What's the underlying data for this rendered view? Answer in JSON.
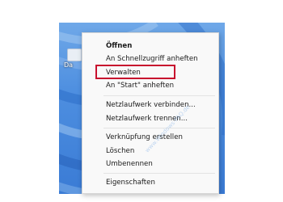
{
  "desktop": {
    "icon_label": "Da"
  },
  "context_menu": {
    "items": [
      {
        "label": "Öffnen",
        "bold": true
      },
      {
        "label": "An Schnellzugriff anheften"
      },
      {
        "label": "Verwalten",
        "highlighted": true
      },
      {
        "label": "An \"Start\" anheften"
      },
      {
        "label": "Netzlaufwerk verbinden..."
      },
      {
        "label": "Netzlaufwerk trennen..."
      },
      {
        "label": "Verknüpfung erstellen"
      },
      {
        "label": "Löschen"
      },
      {
        "label": "Umbenennen"
      },
      {
        "label": "Eigenschaften"
      }
    ]
  },
  "annotation": {
    "highlight_color": "#c8102e"
  },
  "watermark": {
    "text": "www.Windows-FAQ.de"
  }
}
